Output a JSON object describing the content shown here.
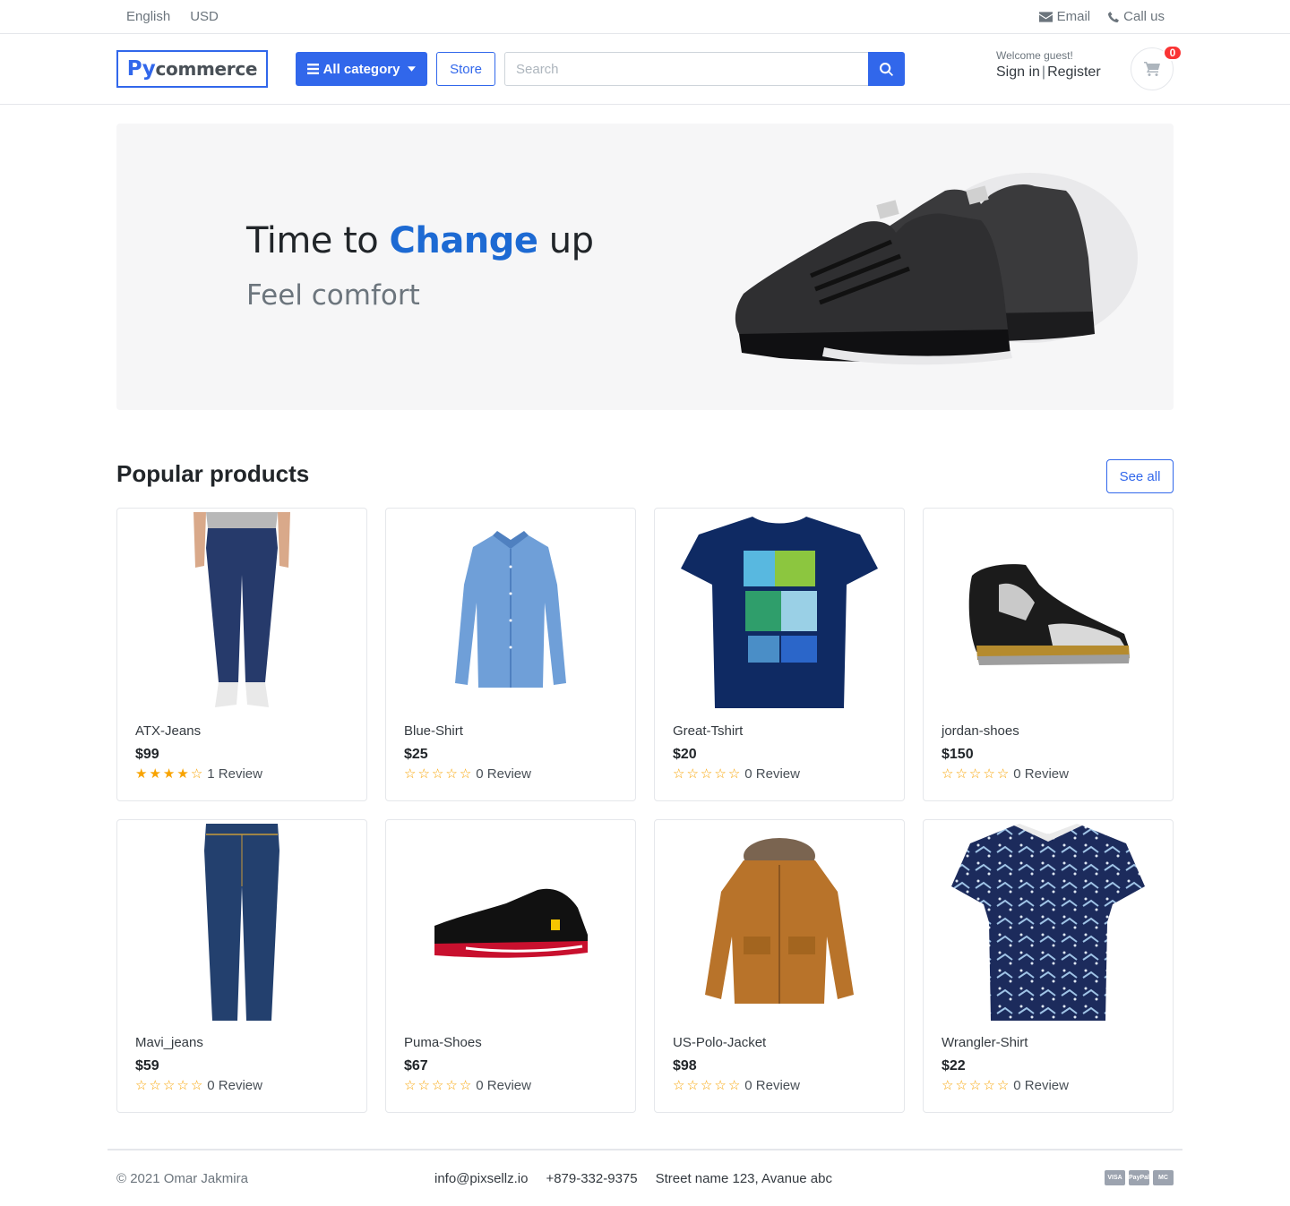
{
  "topbar": {
    "language": "English",
    "currency": "USD",
    "email_label": "Email",
    "call_label": "Call us"
  },
  "header": {
    "logo_py": "Py",
    "logo_rest": "commerce",
    "category_button": "All category",
    "store_button": "Store",
    "search_placeholder": "Search",
    "welcome": "Welcome guest!",
    "sign_in": "Sign in",
    "register": "Register",
    "cart_count": "0"
  },
  "banner": {
    "headline_pre": "Time to ",
    "headline_accent": "Change",
    "headline_post": " up",
    "subtitle": "Feel comfort"
  },
  "products_section": {
    "title": "Popular products",
    "see_all": "See all",
    "products": [
      {
        "name": "ATX-Jeans",
        "price": "$99",
        "rating": 4,
        "reviews": "1 Review",
        "image": "jeans-image"
      },
      {
        "name": "Blue-Shirt",
        "price": "$25",
        "rating": 0,
        "reviews": "0 Review",
        "image": "shirt-image"
      },
      {
        "name": "Great-Tshirt",
        "price": "$20",
        "rating": 0,
        "reviews": "0 Review",
        "image": "tshirt-image"
      },
      {
        "name": "jordan-shoes",
        "price": "$150",
        "rating": 0,
        "reviews": "0 Review",
        "image": "sneaker-image"
      },
      {
        "name": "Mavi_jeans",
        "price": "$59",
        "rating": 0,
        "reviews": "0 Review",
        "image": "jeans-image"
      },
      {
        "name": "Puma-Shoes",
        "price": "$67",
        "rating": 0,
        "reviews": "0 Review",
        "image": "shoe-image"
      },
      {
        "name": "US-Polo-Jacket",
        "price": "$98",
        "rating": 0,
        "reviews": "0 Review",
        "image": "jacket-image"
      },
      {
        "name": "Wrangler-Shirt",
        "price": "$22",
        "rating": 0,
        "reviews": "0 Review",
        "image": "printed-shirt-image"
      }
    ]
  },
  "footer": {
    "copyright": "© 2021 Omar Jakmira",
    "email": "info@pixsellz.io",
    "phone": "+879-332-9375",
    "address": "Street name 123, Avanue abc",
    "payments": [
      "VISA",
      "PayPal",
      "MC"
    ]
  },
  "colors": {
    "primary": "#3167eb",
    "accent_text": "#1d6ad3",
    "star": "#f8a300",
    "badge": "#fa3434"
  }
}
